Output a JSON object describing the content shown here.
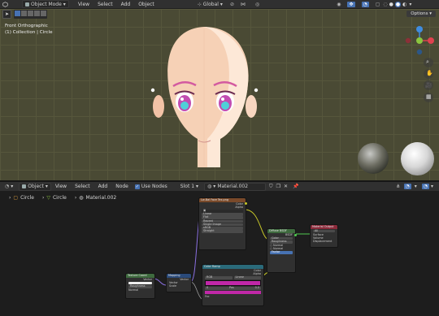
{
  "topbar": {
    "mode": "Object Mode",
    "menus": [
      "View",
      "Select",
      "Add",
      "Object"
    ],
    "transform": "Global",
    "options": "Options"
  },
  "viewport": {
    "view_name": "Front Orthographic",
    "collection": "(1) Collection | Circle",
    "axis_colors": {
      "x": "#e0424f",
      "y": "#8bc63f",
      "z": "#3f8ce0"
    }
  },
  "node_header": {
    "editor": "Object",
    "menus": [
      "View",
      "Select",
      "Add",
      "Node"
    ],
    "use_nodes": "Use Nodes",
    "slot": "Slot 1",
    "material": "Material.002"
  },
  "breadcrumb": {
    "items": [
      "Circle",
      "Circle",
      "Material.002"
    ]
  },
  "nodes": {
    "image": {
      "title": "Lw-Bal Face Tex.png",
      "fields": [
        "Linear",
        "Flat",
        "Repeat",
        "Single Image",
        "sRGB",
        "Straight"
      ]
    },
    "diffuse": {
      "title": "Diffuse BSDF"
    },
    "output": {
      "title": "Material Output",
      "fields": [
        "All",
        "Surface",
        "Volume",
        "Displacement"
      ]
    },
    "texcoord": {
      "title": "Texture Coord"
    },
    "mapping": {
      "title": "Mapping"
    },
    "ramp": {
      "title": "Color Ramp",
      "fields": [
        "RGB",
        "Linear"
      ]
    }
  }
}
